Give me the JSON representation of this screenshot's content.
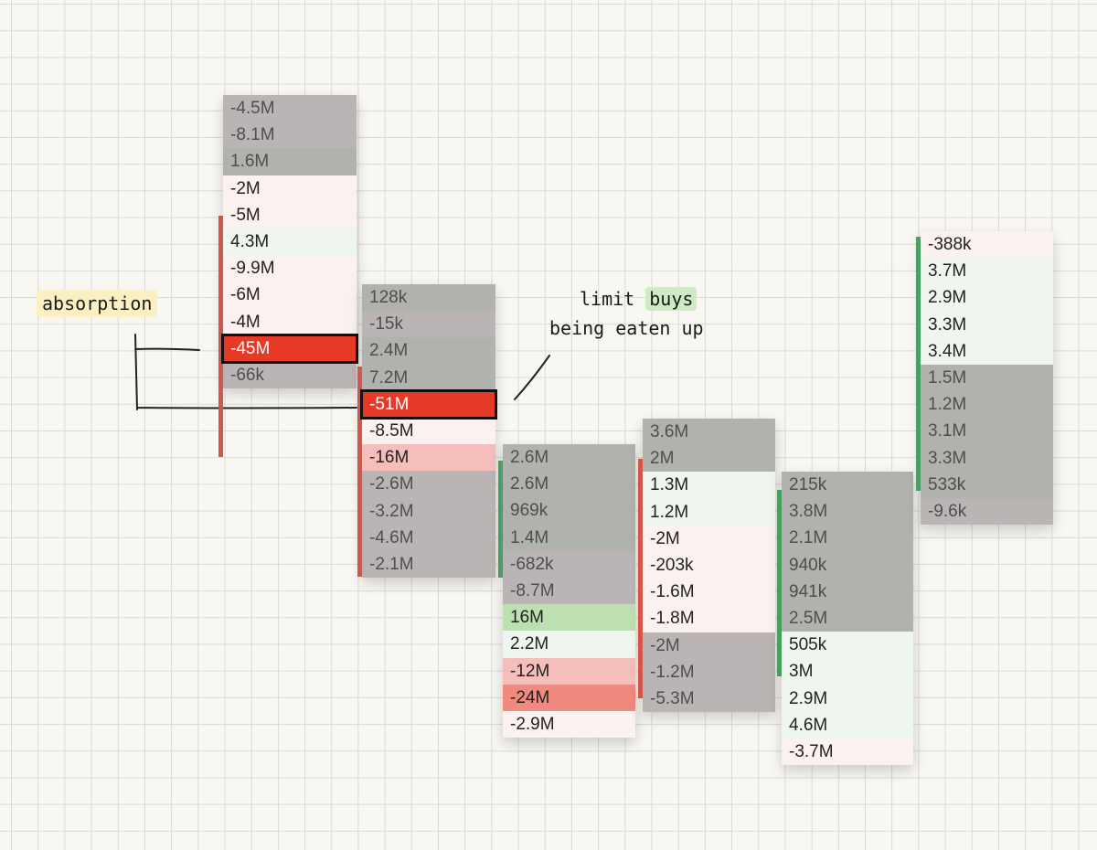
{
  "annotations": {
    "absorption": "absorption",
    "limit_buys_prefix": "limit ",
    "limit_buys_word": "buys",
    "limit_buys_line2": "being eaten up"
  },
  "colors": {
    "gray": "#b5b3b1",
    "pink": "#fbf1f0",
    "mint": "#eff6ef",
    "red": "#e63a27",
    "light_red": "#f6bebb",
    "salmon": "#f0897e",
    "green": "#bde0b1",
    "sell_bar": "#d2574a",
    "buy_bar": "#4a9e63"
  },
  "columns": [
    {
      "cells": [
        {
          "value": "-4.5M",
          "tone": "graypink"
        },
        {
          "value": "-8.1M",
          "tone": "graypink"
        },
        {
          "value": "1.6M",
          "tone": "graygreen"
        },
        {
          "value": "-2M",
          "tone": "pink"
        },
        {
          "value": "-5M",
          "tone": "pink"
        },
        {
          "value": "4.3M",
          "tone": "mint"
        },
        {
          "value": "-9.9M",
          "tone": "pink"
        },
        {
          "value": "-6M",
          "tone": "pink"
        },
        {
          "value": "-4M",
          "tone": "pink"
        },
        {
          "value": "-45M",
          "tone": "red",
          "outlined": true
        },
        {
          "value": "-66k",
          "tone": "graypink"
        }
      ]
    },
    {
      "cells": [
        {
          "value": "128k",
          "tone": "graygreen"
        },
        {
          "value": "-15k",
          "tone": "graypink"
        },
        {
          "value": "2.4M",
          "tone": "graygreen"
        },
        {
          "value": "7.2M",
          "tone": "graygreen"
        },
        {
          "value": "-51M",
          "tone": "red",
          "outlined": true
        },
        {
          "value": "-8.5M",
          "tone": "pink"
        },
        {
          "value": "-16M",
          "tone": "lightred"
        },
        {
          "value": "-2.6M",
          "tone": "graypink"
        },
        {
          "value": "-3.2M",
          "tone": "graypink"
        },
        {
          "value": "-4.6M",
          "tone": "graypink"
        },
        {
          "value": "-2.1M",
          "tone": "graypink"
        }
      ]
    },
    {
      "cells": [
        {
          "value": "2.6M",
          "tone": "graygreen"
        },
        {
          "value": "2.6M",
          "tone": "graygreen"
        },
        {
          "value": "969k",
          "tone": "graygreen"
        },
        {
          "value": "1.4M",
          "tone": "graygreen"
        },
        {
          "value": "-682k",
          "tone": "graypink"
        },
        {
          "value": "-8.7M",
          "tone": "graypink"
        },
        {
          "value": "16M",
          "tone": "green"
        },
        {
          "value": "2.2M",
          "tone": "mint"
        },
        {
          "value": "-12M",
          "tone": "lightred"
        },
        {
          "value": "-24M",
          "tone": "salmon"
        },
        {
          "value": "-2.9M",
          "tone": "pink"
        }
      ]
    },
    {
      "cells": [
        {
          "value": "3.6M",
          "tone": "graygreen"
        },
        {
          "value": "2M",
          "tone": "graygreen"
        },
        {
          "value": "1.3M",
          "tone": "mint"
        },
        {
          "value": "1.2M",
          "tone": "mint"
        },
        {
          "value": "-2M",
          "tone": "pink"
        },
        {
          "value": "-203k",
          "tone": "pink"
        },
        {
          "value": "-1.6M",
          "tone": "pink"
        },
        {
          "value": "-1.8M",
          "tone": "pink"
        },
        {
          "value": "-2M",
          "tone": "graypink"
        },
        {
          "value": "-1.2M",
          "tone": "graypink"
        },
        {
          "value": "-5.3M",
          "tone": "graypink"
        }
      ]
    },
    {
      "cells": [
        {
          "value": "215k",
          "tone": "graygreen"
        },
        {
          "value": "3.8M",
          "tone": "graygreen"
        },
        {
          "value": "2.1M",
          "tone": "graygreen"
        },
        {
          "value": "940k",
          "tone": "graygreen"
        },
        {
          "value": "941k",
          "tone": "graygreen"
        },
        {
          "value": "2.5M",
          "tone": "graygreen"
        },
        {
          "value": "505k",
          "tone": "mint"
        },
        {
          "value": "3M",
          "tone": "mint"
        },
        {
          "value": "2.9M",
          "tone": "mint"
        },
        {
          "value": "4.6M",
          "tone": "mint"
        },
        {
          "value": "-3.7M",
          "tone": "pink"
        }
      ]
    },
    {
      "cells": [
        {
          "value": "-388k",
          "tone": "pink"
        },
        {
          "value": "3.7M",
          "tone": "mint"
        },
        {
          "value": "2.9M",
          "tone": "mint"
        },
        {
          "value": "3.3M",
          "tone": "mint"
        },
        {
          "value": "3.4M",
          "tone": "mint"
        },
        {
          "value": "1.5M",
          "tone": "graygreen"
        },
        {
          "value": "1.2M",
          "tone": "graygreen"
        },
        {
          "value": "3.1M",
          "tone": "graygreen"
        },
        {
          "value": "3.3M",
          "tone": "graygreen"
        },
        {
          "value": "533k",
          "tone": "graygreen"
        },
        {
          "value": "-9.6k",
          "tone": "graypink"
        }
      ]
    }
  ]
}
